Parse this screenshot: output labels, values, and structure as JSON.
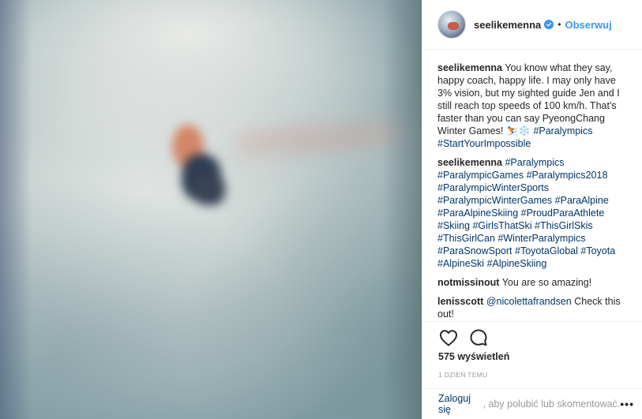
{
  "post": {
    "username": "seelikemenna",
    "follow_label": "Obserwuj",
    "separator": "•",
    "verified_icon": "verified-badge-icon"
  },
  "comments": [
    {
      "author": "seelikemenna",
      "text": "You know what they say, happy coach, happy life. I may only have 3% vision, but my sighted guide Jen and I still reach top speeds of 100 km/h. That's faster than you can say PyeongChang Winter Games! ⛷️❄️",
      "tags": [
        "#Paralympics",
        "#StartYourImpossible"
      ]
    },
    {
      "author": "seelikemenna",
      "text": "",
      "tags": [
        "#Paralympics",
        "#ParalympicGames",
        "#Paralympics2018",
        "#ParalympicWinterSports",
        "#ParalympicWinterGames",
        "#ParaAlpine",
        "#ParaAlpineSkiing",
        "#ProudParaAthlete",
        "#Skiing",
        "#GirlsThatSki",
        "#ThisGirlSkis",
        "#ThisGirlCan",
        "#WinterParalympics",
        "#ParaSnowSport",
        "#ToyotaGlobal",
        "#Toyota",
        "#AlpineSki",
        "#AlpineSkiing"
      ]
    },
    {
      "author": "notmissinout",
      "text": "You are so amazing!"
    },
    {
      "author": "lenisscott",
      "mention": "@nicolettafrandsen",
      "text": "Check this out!"
    }
  ],
  "actions": {
    "like_icon": "heart-icon",
    "comment_icon": "comment-bubble-icon"
  },
  "views": "575 wyświetleń",
  "timestamp": "1 dzień temu",
  "login_prompt": {
    "link": "Zaloguj się",
    "rest": ", aby polubić lub skomentować.",
    "more": "•••"
  },
  "colors": {
    "link": "#003569",
    "accent": "#3897f0",
    "muted": "#999999",
    "text": "#262626",
    "border": "#efefef"
  }
}
